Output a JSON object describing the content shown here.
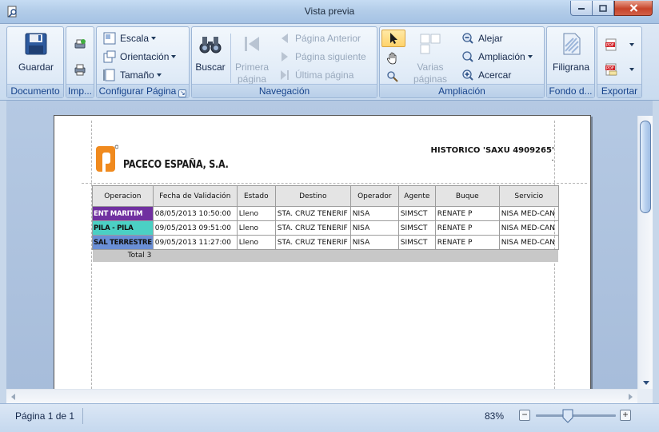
{
  "window": {
    "title": "Vista previa"
  },
  "ribbon": {
    "documento": {
      "label": "Documento",
      "guardar": "Guardar"
    },
    "imprimir": {
      "label": "Imp..."
    },
    "configurar": {
      "label": "Configurar Página",
      "escala": "Escala",
      "orientacion": "Orientación",
      "tamano": "Tamaño"
    },
    "navegacion": {
      "label": "Navegación",
      "buscar": "Buscar",
      "primera": "Primera página",
      "anterior": "Página Anterior",
      "siguiente": "Página siguiente",
      "ultima": "Última página"
    },
    "ampliacion": {
      "label": "Ampliación",
      "varias": "Varias páginas",
      "alejar": "Alejar",
      "ampliacion": "Ampliación",
      "acercar": "Acercar"
    },
    "fondo": {
      "label": "Fondo d...",
      "filigrana": "Filigrana"
    },
    "exportar": {
      "label": "Exportar"
    }
  },
  "report": {
    "company": "PACECO ESPAÑA, S.A.",
    "title": "HISTORICO  'SAXU 4909265'",
    "columns": [
      "Operacion",
      "Fecha de Validación",
      "Estado",
      "Destino",
      "Operador",
      "Agente",
      "Buque",
      "Servicio"
    ],
    "rows": [
      {
        "operacion": "ENT MARITIM",
        "color": "#7030a0",
        "text_color": "#ffffff",
        "fecha": "08/05/2013 10:50:00",
        "estado": "Lleno",
        "destino": "STA. CRUZ  TENERIF",
        "operador": "NISA",
        "agente": "SIMSCT",
        "buque": "RENATE P",
        "servicio": "NISA MED-CAN"
      },
      {
        "operacion": "PILA - PILA",
        "color": "#4bd0c4",
        "text_color": "#111111",
        "fecha": "09/05/2013 09:51:00",
        "estado": "Lleno",
        "destino": "STA. CRUZ  TENERIF",
        "operador": "NISA",
        "agente": "SIMSCT",
        "buque": "RENATE P",
        "servicio": "NISA MED-CAN"
      },
      {
        "operacion": "SAL TERRESTRE",
        "color": "#6a8fd6",
        "text_color": "#111111",
        "fecha": "09/05/2013 11:27:00",
        "estado": "Lleno",
        "destino": "STA. CRUZ  TENERIF",
        "operador": "NISA",
        "agente": "SIMSCT",
        "buque": "RENATE P",
        "servicio": "NISA MED-CAN"
      }
    ],
    "total": "Total 3"
  },
  "status": {
    "page": "Página 1 de 1",
    "zoom": "83%",
    "zoom_fraction": 0.83
  },
  "colors": {
    "logo_orange": "#f08a1e"
  }
}
